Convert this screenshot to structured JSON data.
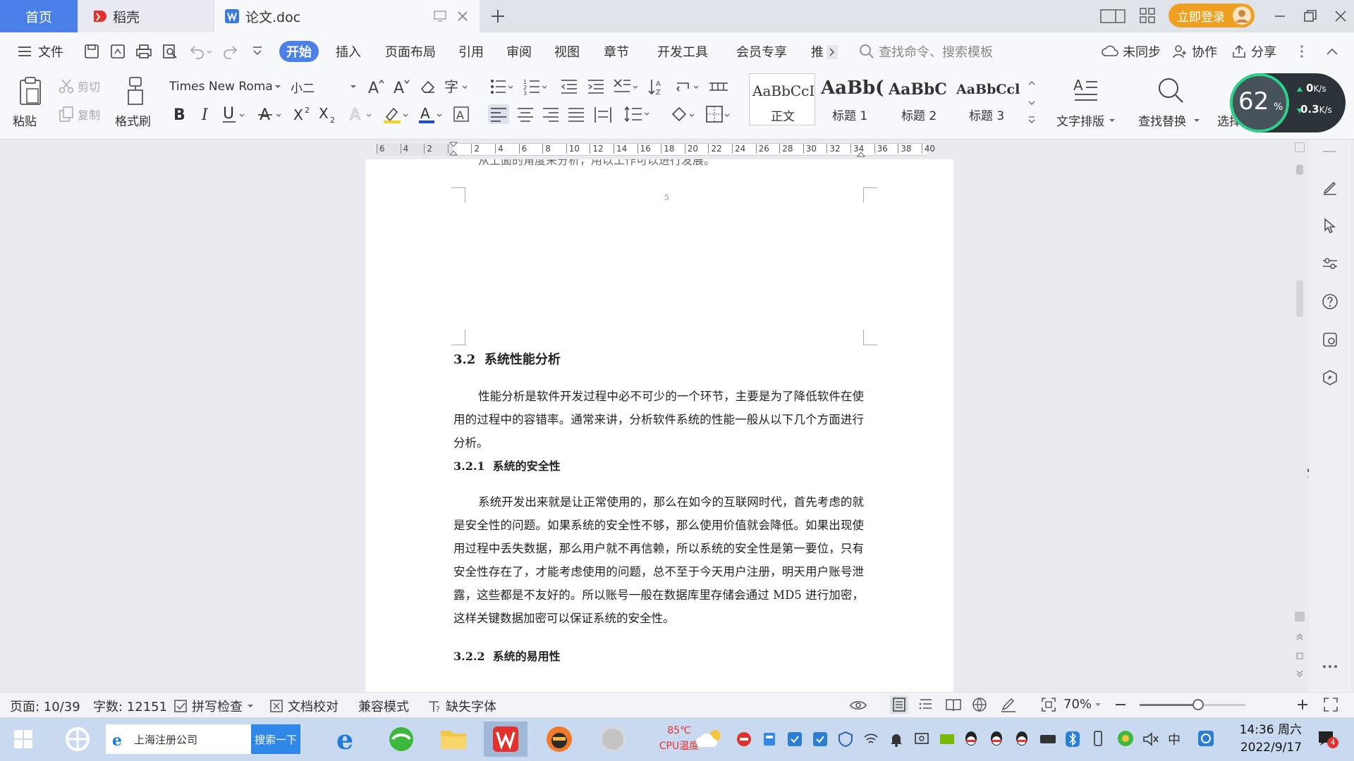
{
  "tabs": {
    "home": "首页",
    "docer": "稻壳",
    "document": "论文.doc"
  },
  "titlebar": {
    "login": "立即登录"
  },
  "menu": {
    "file": "文件",
    "items": [
      "开始",
      "插入",
      "页面布局",
      "引用",
      "审阅",
      "视图",
      "章节",
      "开发工具",
      "会员专享",
      "推"
    ],
    "search_placeholder": "查找命令、搜索模板",
    "sync": "未同步",
    "collab": "协作",
    "share": "分享"
  },
  "ribbon": {
    "paste": "粘贴",
    "cut": "剪切",
    "copy": "复制",
    "format_painter": "格式刷",
    "font_name": "Times New Roma",
    "font_size": "小二",
    "styles": [
      {
        "preview": "AaBbCcI",
        "label": "正文"
      },
      {
        "preview": "AaBb(",
        "label": "标题 1"
      },
      {
        "preview": "AaBbC",
        "label": "标题 2"
      },
      {
        "preview": "AaBbCcl",
        "label": "标题 3"
      }
    ],
    "text_layout": "文字排版",
    "find_replace": "查找替换",
    "select": "选择"
  },
  "speed_widget": {
    "percent": "62",
    "percent_unit": "%",
    "up": "0",
    "up_unit": "K/s",
    "down": "0.3",
    "down_unit": "K/s"
  },
  "ruler_ticks": [
    "6",
    "4",
    "2",
    "",
    "2",
    "4",
    "6",
    "8",
    "10",
    "12",
    "14",
    "16",
    "18",
    "20",
    "22",
    "24",
    "26",
    "28",
    "30",
    "32",
    "34",
    "36",
    "38",
    "40"
  ],
  "document": {
    "prev_page_tail": "从上面的角度来分析，用以工作可以进行发展。",
    "prev_page_number": "5",
    "h2": "3.2  系统性能分析",
    "p1": "性能分析是软件开发过程中必不可少的一个环节，主要是为了降低软件在使用的过程中的容错率。通常来讲，分析软件系统的性能一般从以下几个方面进行分析。",
    "h3a": "3.2.1  系统的安全性",
    "p2": "系统开发出来就是让正常使用的，那么在如今的互联网时代，首先考虑的就是安全性的问题。如果系统的安全性不够，那么使用价值就会降低。如果出现使用过程中丢失数据，那么用户就不再信赖，所以系统的安全性是第一要位，只有安全性存在了，才能考虑使用的问题，总不至于今天用户注册，明天用户账号泄露，这些都是不友好的。所以账号一般在数据库里存储会通过 MD5 进行加密，这样关键数据加密可以保证系统的安全性。",
    "h3b": "3.2.2  系统的易用性"
  },
  "statusbar": {
    "page": "页面: 10/39",
    "words": "字数: 12151",
    "spell": "拼写检查",
    "proof": "文档校对",
    "compat": "兼容模式",
    "missing_font": "缺失字体",
    "zoom": "70%",
    "zoom_fraction": 0.55
  },
  "taskbar": {
    "search_text": "上海注册公司",
    "search_button": "搜索一下",
    "cpu_temp": "85℃",
    "cpu_label": "CPU温度",
    "ime": "中",
    "time": "14:36 周六",
    "date": "2022/9/17",
    "notif_count": "4"
  },
  "colors": {
    "accent": "#4b80e8",
    "login_bg": "#f0a020",
    "wps_red": "#e3322e"
  }
}
